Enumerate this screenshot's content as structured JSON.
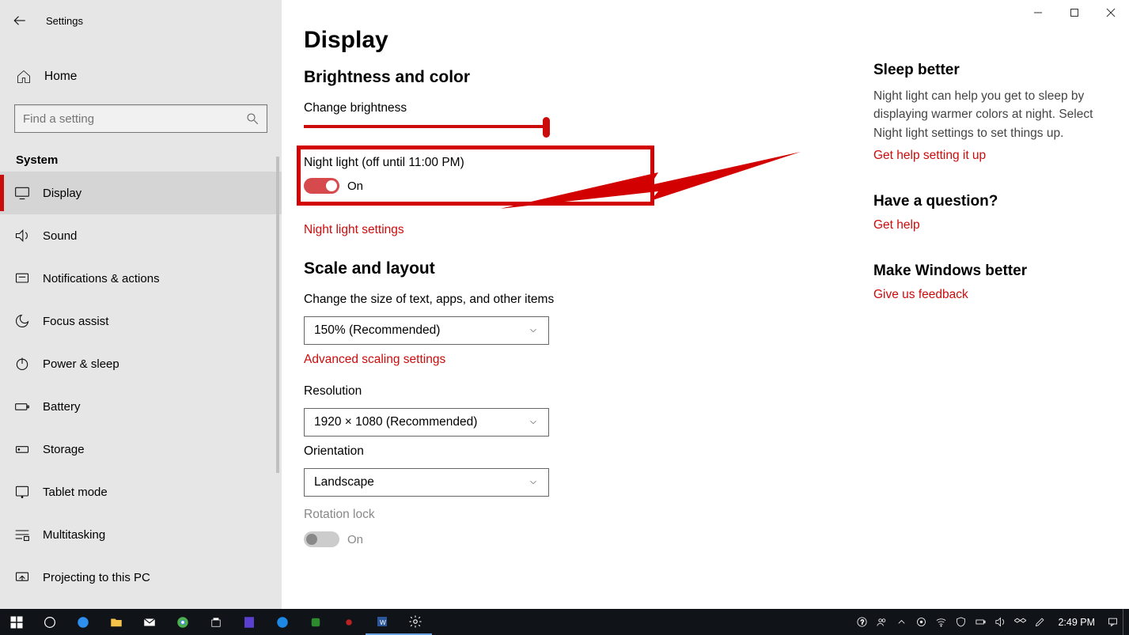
{
  "window": {
    "title": "Settings"
  },
  "sidebar": {
    "home_label": "Home",
    "search_placeholder": "Find a setting",
    "category": "System",
    "items": [
      {
        "label": "Display"
      },
      {
        "label": "Sound"
      },
      {
        "label": "Notifications & actions"
      },
      {
        "label": "Focus assist"
      },
      {
        "label": "Power & sleep"
      },
      {
        "label": "Battery"
      },
      {
        "label": "Storage"
      },
      {
        "label": "Tablet mode"
      },
      {
        "label": "Multitasking"
      },
      {
        "label": "Projecting to this PC"
      }
    ]
  },
  "main": {
    "title": "Display",
    "brightness_section": "Brightness and color",
    "brightness_label": "Change brightness",
    "night_light_label": "Night light (off until 11:00 PM)",
    "night_light_state": "On",
    "night_light_settings_link": "Night light settings",
    "scale_section": "Scale and layout",
    "scale_label": "Change the size of text, apps, and other items",
    "scale_value": "150% (Recommended)",
    "advanced_scaling_link": "Advanced scaling settings",
    "resolution_label": "Resolution",
    "resolution_value": "1920 × 1080 (Recommended)",
    "orientation_label": "Orientation",
    "orientation_value": "Landscape",
    "rotation_lock_label": "Rotation lock",
    "rotation_lock_state": "On"
  },
  "aside": {
    "sleep_title": "Sleep better",
    "sleep_body": "Night light can help you get to sleep by displaying warmer colors at night. Select Night light settings to set things up.",
    "sleep_link": "Get help setting it up",
    "question_title": "Have a question?",
    "question_link": "Get help",
    "feedback_title": "Make Windows better",
    "feedback_link": "Give us feedback"
  },
  "taskbar": {
    "time": "2:49 PM"
  },
  "colors": {
    "accent": "#cc0b0b",
    "annotation": "#d20000"
  }
}
